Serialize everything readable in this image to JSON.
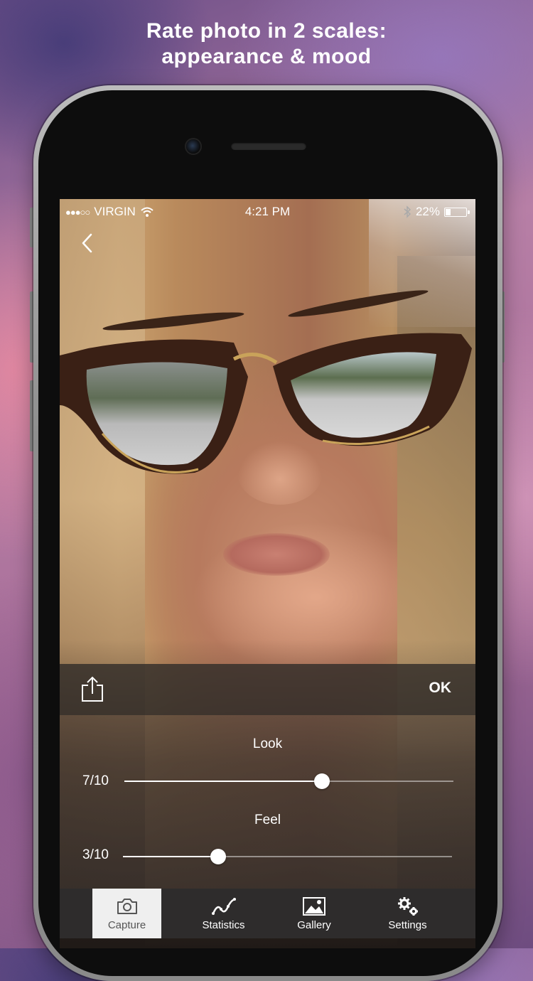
{
  "headline": {
    "line1": "Rate photo in 2 scales:",
    "line2": "appearance & mood"
  },
  "status_bar": {
    "signal": "●●●○○",
    "carrier": "VIRGIN",
    "time": "4:21 PM",
    "battery_percent": "22%",
    "battery_level": 0.22
  },
  "actions": {
    "ok_label": "OK"
  },
  "ratings": {
    "look": {
      "title": "Look",
      "value_text": "7/10",
      "value": 7,
      "max": 10,
      "fill_fraction": 0.6
    },
    "feel": {
      "title": "Feel",
      "value_text": "3/10",
      "value": 3,
      "max": 10,
      "fill_fraction": 0.29
    }
  },
  "tabs": [
    {
      "label": "Capture",
      "icon": "camera-icon",
      "active": true
    },
    {
      "label": "Statistics",
      "icon": "line-chart-icon",
      "active": false
    },
    {
      "label": "Gallery",
      "icon": "image-icon",
      "active": false
    },
    {
      "label": "Settings",
      "icon": "gears-icon",
      "active": false
    }
  ],
  "colors": {
    "tab_bar": "#2e2c2c",
    "tab_active": "#efefef",
    "slider_active": "#ffffff"
  }
}
